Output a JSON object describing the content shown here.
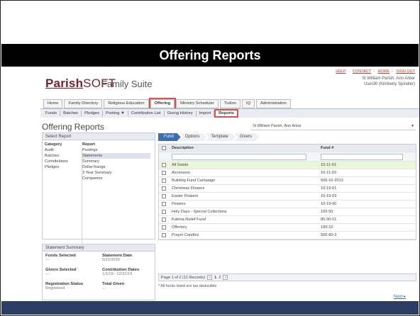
{
  "slide": {
    "title": "Offering Reports"
  },
  "header": {
    "links": [
      "HELP",
      "CONTACT",
      "HOME",
      "SIGN OUT"
    ],
    "parish_line": "St William Parish, Ann Arbor",
    "user_line": "User30 (Kimberly Spindler)",
    "logo_parish": "Parish",
    "logo_soft": "SOFT",
    "suite": "Family Suite"
  },
  "main_nav": [
    "Home",
    "Family Directory",
    "Religious Education",
    "Offering",
    "Ministry Scheduler",
    "Tuition",
    "IQ",
    "Administration"
  ],
  "main_nav_active": "Offering",
  "sub_nav": [
    "Funds",
    "Batches",
    "Pledges",
    "Posting ▼",
    "Contribution List",
    "Giving History",
    "Import",
    "Reports"
  ],
  "page": {
    "title": "Offering Reports",
    "parish_selector": "St William Parish, Ann Arbor"
  },
  "select_report": {
    "heading": "Select Report",
    "category_header": "Category",
    "report_header": "Report",
    "categories": [
      "Audit",
      "Batches",
      "Contributions",
      "Pledges"
    ],
    "reports": [
      "Postings",
      "Statements",
      "Summary",
      "Dollar Range",
      "3 Year Summary",
      "Companion"
    ],
    "selected_report": "Statements"
  },
  "statement_summary": {
    "heading": "Statement Summary",
    "items": [
      {
        "label": "Funds Selected",
        "value": "---"
      },
      {
        "label": "Statement Date",
        "value": "5/21/2019"
      },
      {
        "label": "Givers Selected",
        "value": "---"
      },
      {
        "label": "Contribution Dates",
        "value": "1/1/19 - 12/31/19"
      },
      {
        "label": "Registration Status",
        "value": "Registered"
      },
      {
        "label": "Total Given",
        "value": "..."
      }
    ]
  },
  "wizard_steps": [
    "Fund",
    "Options",
    "Template",
    "Givers"
  ],
  "fund_table": {
    "columns": [
      "Description",
      "Fund #"
    ],
    "rows": [
      {
        "description": "All Saints",
        "fund": "10-11-01",
        "highlight": true
      },
      {
        "description": "Ascension",
        "fund": "10-11-03"
      },
      {
        "description": "Building Fund Campaign",
        "fund": "500-10-2013"
      },
      {
        "description": "Christmas Flowers",
        "fund": "10-19-01"
      },
      {
        "description": "Easter Flowers",
        "fund": "10-19-03"
      },
      {
        "description": "Flowers",
        "fund": "10-19-00"
      },
      {
        "description": "Holy Days - Special Collections",
        "fund": "100-50"
      },
      {
        "description": "Katrina Relief Fund",
        "fund": "85-90-01"
      },
      {
        "description": "Offertory",
        "fund": "100-10"
      },
      {
        "description": "Prayer Candles",
        "fund": "500-60-3"
      }
    ]
  },
  "pager": {
    "summary": "Page 1 of 2 (11 Records)",
    "prev": "<",
    "pages": [
      "1",
      "2"
    ],
    "next": ">"
  },
  "footnote": "* All funds listed are tax-deductible",
  "next_link": "Next ▸",
  "colors": {
    "brand": "#7a1f2b",
    "accent": "#3d6fb0",
    "highlight_box": "#d9534f",
    "selected_row": "#eaf6d8"
  }
}
